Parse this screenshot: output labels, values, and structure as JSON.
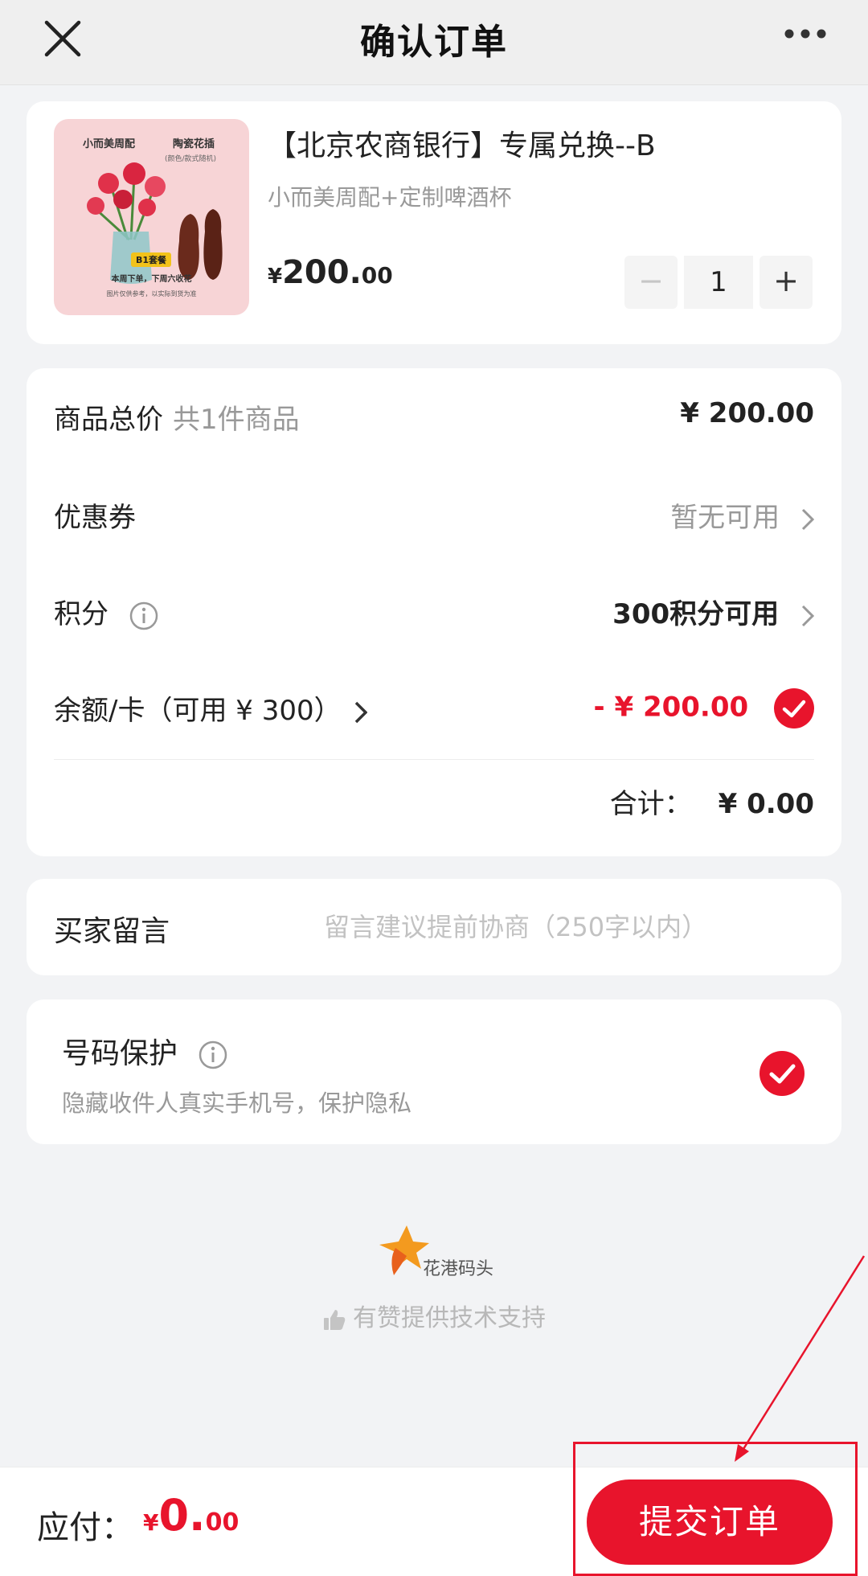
{
  "header": {
    "title": "确认订单",
    "close_icon": "close-icon",
    "more_icon": "more-icon"
  },
  "product": {
    "name": "【北京农商银行】专属兑换--B",
    "spec": "小而美周配+定制啤酒杯",
    "price_symbol": "¥",
    "price_integer": "200.",
    "price_decimal": "00",
    "quantity": "1",
    "minus_label": "−",
    "plus_label": "+",
    "thumbnail": {
      "title_left": "小而美周配",
      "title_right": "陶瓷花插",
      "subtitle_right": "(颜色/款式随机)",
      "badge": "B1套餐",
      "line1": "本周下单，下周六收花",
      "line2": "图片仅供参考，以实际到货为准"
    }
  },
  "summary": {
    "total_label": "商品总价",
    "total_count": "共1件商品",
    "total_value": "¥ 200.00",
    "coupon_label": "优惠券",
    "coupon_value": "暂无可用",
    "points_label": "积分",
    "points_value": "300积分可用",
    "balance_label": "余额/卡（可用 ¥ 300）",
    "balance_value": "- ¥ 200.00",
    "balance_checked": true,
    "subtotal_label": "合计：",
    "subtotal_value": "¥ 0.00"
  },
  "message": {
    "label": "买家留言",
    "placeholder": "留言建议提前协商（250字以内）",
    "value": ""
  },
  "privacy": {
    "title": "号码保护",
    "description": "隐藏收件人真实手机号，保护隐私",
    "checked": true
  },
  "brand": {
    "name": "花港码头",
    "support": "有赞提供技术支持"
  },
  "footer": {
    "pay_label": "应付：",
    "pay_symbol": "¥",
    "pay_integer": "0.",
    "pay_decimal": "00",
    "submit_label": "提交订单"
  },
  "colors": {
    "accent": "#e8142c",
    "background": "#f2f3f5",
    "muted_text": "#999999"
  }
}
